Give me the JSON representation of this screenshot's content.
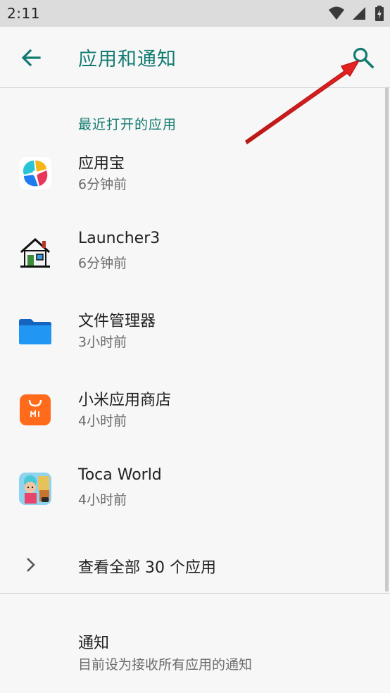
{
  "status_bar": {
    "time": "2:11"
  },
  "app_bar": {
    "title": "应用和通知"
  },
  "recent_section": {
    "header": "最近打开的应用"
  },
  "apps": [
    {
      "name": "应用宝",
      "time": "6分钟前",
      "icon": "yingyongbao-icon"
    },
    {
      "name": "Launcher3",
      "time": "6分钟前",
      "icon": "launcher-house-icon"
    },
    {
      "name": "文件管理器",
      "time": "3小时前",
      "icon": "folder-icon"
    },
    {
      "name": "小米应用商店",
      "time": "4小时前",
      "icon": "mi-store-icon"
    },
    {
      "name": "Toca World",
      "time": "4小时前",
      "icon": "toca-world-icon"
    }
  ],
  "see_all": {
    "label": "查看全部 30 个应用"
  },
  "notifications": {
    "title": "通知",
    "subtitle": "目前设为接收所有应用的通知"
  },
  "colors": {
    "accent": "#137b72",
    "annotation_arrow": "#e02020"
  }
}
